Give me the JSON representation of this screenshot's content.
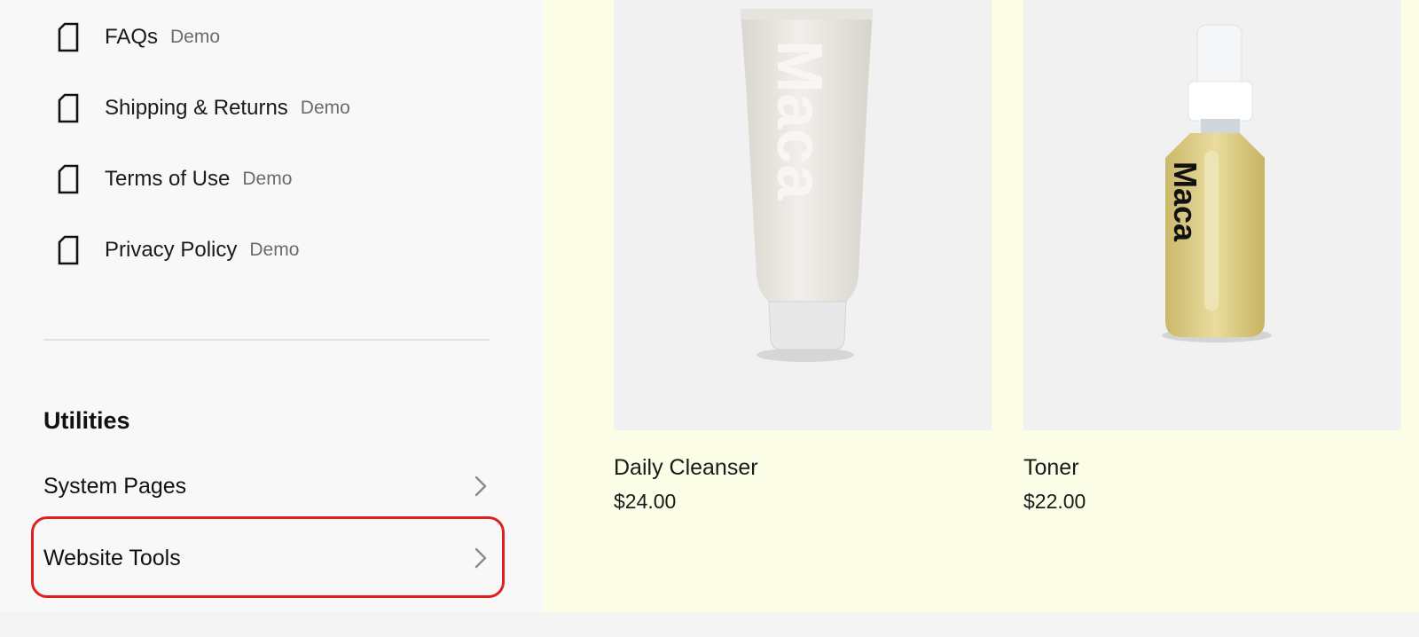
{
  "pages": [
    {
      "label": "FAQs",
      "badge": "Demo",
      "icon": "page-icon"
    },
    {
      "label": "Shipping & Returns",
      "badge": "Demo",
      "icon": "page-icon"
    },
    {
      "label": "Terms of Use",
      "badge": "Demo",
      "icon": "page-icon"
    },
    {
      "label": "Privacy Policy",
      "badge": "Demo",
      "icon": "page-icon"
    }
  ],
  "utilities": {
    "title": "Utilities",
    "items": [
      {
        "label": "System Pages",
        "icon": "chevron-right-icon"
      },
      {
        "label": "Website Tools",
        "icon": "chevron-right-icon",
        "highlighted": true
      }
    ]
  },
  "products": [
    {
      "name": "Daily Cleanser",
      "price": "$24.00",
      "brand_text": "Maca"
    },
    {
      "name": "Toner",
      "price": "$22.00",
      "brand_text": "Maca"
    }
  ],
  "colors": {
    "highlight": "#e0201f",
    "main_background": "#fbfde6",
    "sidebar_background": "#f8f8f8"
  }
}
